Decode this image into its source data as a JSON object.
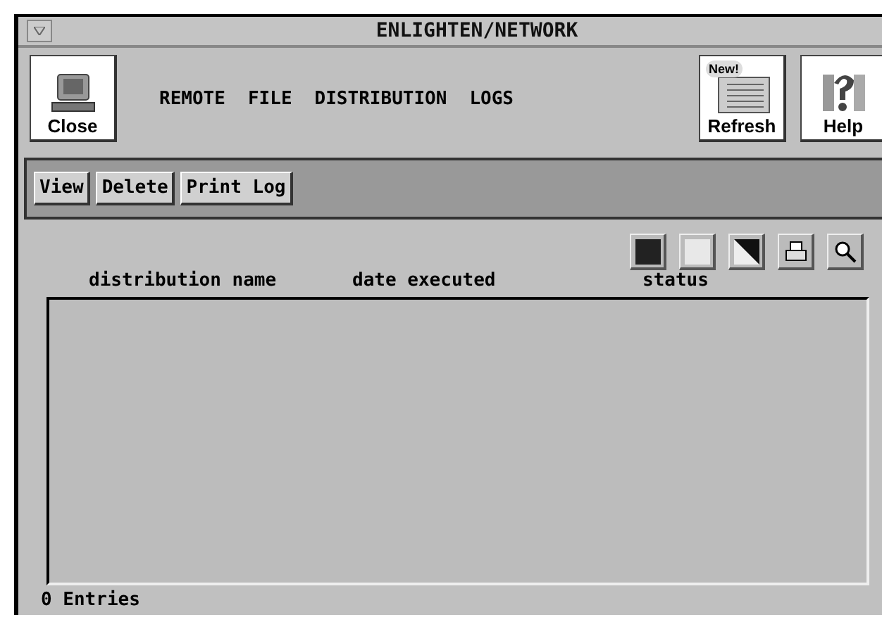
{
  "window": {
    "title": "ENLIGHTEN/NETWORK"
  },
  "toolbar": {
    "left_buttons": [
      {
        "label": "Close",
        "kind": "computer"
      }
    ],
    "menu": [
      "REMOTE",
      "FILE",
      "DISTRIBUTION",
      "LOGS"
    ],
    "right_buttons": [
      {
        "label": "Refresh",
        "kind": "news",
        "badge": "New!"
      },
      {
        "label": "Help",
        "kind": "help"
      }
    ]
  },
  "actions": [
    "View",
    "Delete",
    "Print Log"
  ],
  "list_tools": [
    {
      "kind": "dark"
    },
    {
      "kind": "light"
    },
    {
      "kind": "split"
    },
    {
      "kind": "printer"
    },
    {
      "kind": "search"
    }
  ],
  "table": {
    "columns": [
      "distribution name",
      "date executed",
      "status"
    ]
  },
  "status_bar": "0 Entries"
}
